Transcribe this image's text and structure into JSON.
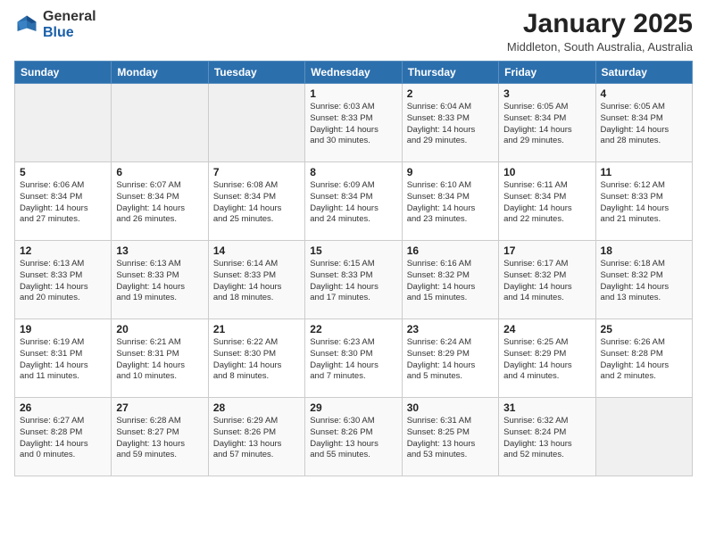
{
  "header": {
    "logo_general": "General",
    "logo_blue": "Blue",
    "month_title": "January 2025",
    "location": "Middleton, South Australia, Australia"
  },
  "days_of_week": [
    "Sunday",
    "Monday",
    "Tuesday",
    "Wednesday",
    "Thursday",
    "Friday",
    "Saturday"
  ],
  "weeks": [
    [
      {
        "day": "",
        "info": ""
      },
      {
        "day": "",
        "info": ""
      },
      {
        "day": "",
        "info": ""
      },
      {
        "day": "1",
        "info": "Sunrise: 6:03 AM\nSunset: 8:33 PM\nDaylight: 14 hours\nand 30 minutes."
      },
      {
        "day": "2",
        "info": "Sunrise: 6:04 AM\nSunset: 8:33 PM\nDaylight: 14 hours\nand 29 minutes."
      },
      {
        "day": "3",
        "info": "Sunrise: 6:05 AM\nSunset: 8:34 PM\nDaylight: 14 hours\nand 29 minutes."
      },
      {
        "day": "4",
        "info": "Sunrise: 6:05 AM\nSunset: 8:34 PM\nDaylight: 14 hours\nand 28 minutes."
      }
    ],
    [
      {
        "day": "5",
        "info": "Sunrise: 6:06 AM\nSunset: 8:34 PM\nDaylight: 14 hours\nand 27 minutes."
      },
      {
        "day": "6",
        "info": "Sunrise: 6:07 AM\nSunset: 8:34 PM\nDaylight: 14 hours\nand 26 minutes."
      },
      {
        "day": "7",
        "info": "Sunrise: 6:08 AM\nSunset: 8:34 PM\nDaylight: 14 hours\nand 25 minutes."
      },
      {
        "day": "8",
        "info": "Sunrise: 6:09 AM\nSunset: 8:34 PM\nDaylight: 14 hours\nand 24 minutes."
      },
      {
        "day": "9",
        "info": "Sunrise: 6:10 AM\nSunset: 8:34 PM\nDaylight: 14 hours\nand 23 minutes."
      },
      {
        "day": "10",
        "info": "Sunrise: 6:11 AM\nSunset: 8:34 PM\nDaylight: 14 hours\nand 22 minutes."
      },
      {
        "day": "11",
        "info": "Sunrise: 6:12 AM\nSunset: 8:33 PM\nDaylight: 14 hours\nand 21 minutes."
      }
    ],
    [
      {
        "day": "12",
        "info": "Sunrise: 6:13 AM\nSunset: 8:33 PM\nDaylight: 14 hours\nand 20 minutes."
      },
      {
        "day": "13",
        "info": "Sunrise: 6:13 AM\nSunset: 8:33 PM\nDaylight: 14 hours\nand 19 minutes."
      },
      {
        "day": "14",
        "info": "Sunrise: 6:14 AM\nSunset: 8:33 PM\nDaylight: 14 hours\nand 18 minutes."
      },
      {
        "day": "15",
        "info": "Sunrise: 6:15 AM\nSunset: 8:33 PM\nDaylight: 14 hours\nand 17 minutes."
      },
      {
        "day": "16",
        "info": "Sunrise: 6:16 AM\nSunset: 8:32 PM\nDaylight: 14 hours\nand 15 minutes."
      },
      {
        "day": "17",
        "info": "Sunrise: 6:17 AM\nSunset: 8:32 PM\nDaylight: 14 hours\nand 14 minutes."
      },
      {
        "day": "18",
        "info": "Sunrise: 6:18 AM\nSunset: 8:32 PM\nDaylight: 14 hours\nand 13 minutes."
      }
    ],
    [
      {
        "day": "19",
        "info": "Sunrise: 6:19 AM\nSunset: 8:31 PM\nDaylight: 14 hours\nand 11 minutes."
      },
      {
        "day": "20",
        "info": "Sunrise: 6:21 AM\nSunset: 8:31 PM\nDaylight: 14 hours\nand 10 minutes."
      },
      {
        "day": "21",
        "info": "Sunrise: 6:22 AM\nSunset: 8:30 PM\nDaylight: 14 hours\nand 8 minutes."
      },
      {
        "day": "22",
        "info": "Sunrise: 6:23 AM\nSunset: 8:30 PM\nDaylight: 14 hours\nand 7 minutes."
      },
      {
        "day": "23",
        "info": "Sunrise: 6:24 AM\nSunset: 8:29 PM\nDaylight: 14 hours\nand 5 minutes."
      },
      {
        "day": "24",
        "info": "Sunrise: 6:25 AM\nSunset: 8:29 PM\nDaylight: 14 hours\nand 4 minutes."
      },
      {
        "day": "25",
        "info": "Sunrise: 6:26 AM\nSunset: 8:28 PM\nDaylight: 14 hours\nand 2 minutes."
      }
    ],
    [
      {
        "day": "26",
        "info": "Sunrise: 6:27 AM\nSunset: 8:28 PM\nDaylight: 14 hours\nand 0 minutes."
      },
      {
        "day": "27",
        "info": "Sunrise: 6:28 AM\nSunset: 8:27 PM\nDaylight: 13 hours\nand 59 minutes."
      },
      {
        "day": "28",
        "info": "Sunrise: 6:29 AM\nSunset: 8:26 PM\nDaylight: 13 hours\nand 57 minutes."
      },
      {
        "day": "29",
        "info": "Sunrise: 6:30 AM\nSunset: 8:26 PM\nDaylight: 13 hours\nand 55 minutes."
      },
      {
        "day": "30",
        "info": "Sunrise: 6:31 AM\nSunset: 8:25 PM\nDaylight: 13 hours\nand 53 minutes."
      },
      {
        "day": "31",
        "info": "Sunrise: 6:32 AM\nSunset: 8:24 PM\nDaylight: 13 hours\nand 52 minutes."
      },
      {
        "day": "",
        "info": ""
      }
    ]
  ]
}
